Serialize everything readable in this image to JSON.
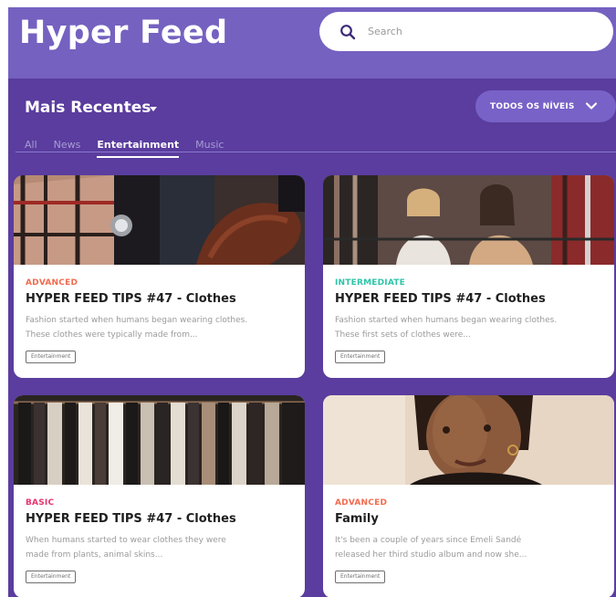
{
  "app": {
    "title": "Hyper Feed"
  },
  "search": {
    "placeholder": "Search"
  },
  "filters": {
    "sort_label": "Mais Recentes",
    "level_button": "TODOS OS NÍVEIS",
    "tabs": [
      {
        "label": "All",
        "active": false
      },
      {
        "label": "News",
        "active": false
      },
      {
        "label": "Entertainment",
        "active": true
      },
      {
        "label": "Music",
        "active": false
      }
    ]
  },
  "cards": [
    {
      "level": "ADVANCED",
      "level_color": "#f26b4f",
      "title": "HYPER FEED TIPS #47 - Clothes",
      "desc_1": "Fashion started when humans began wearing clothes.",
      "desc_2": "These clothes were typically made from...",
      "tag": "Entertainment",
      "image": "clothes-closeup-image"
    },
    {
      "level": "INTERMEDIATE",
      "level_color": "#2ec5a8",
      "title": "HYPER FEED TIPS #47 - Clothes",
      "desc_1": "Fashion started when humans began wearing clothes.",
      "desc_2": "These first sets of clothes were...",
      "tag": "Entertainment",
      "image": "shopping-women-image"
    },
    {
      "level": "BASIC",
      "level_color": "#e8336d",
      "title": "HYPER FEED TIPS #47 - Clothes",
      "desc_1": "When humans started to wear clothes they were",
      "desc_2": "made from plants, animal skins...",
      "tag": "Entertainment",
      "image": "clothing-rack-image"
    },
    {
      "level": "ADVANCED",
      "level_color": "#f26b4f",
      "title": "Family",
      "desc_1": "It's been a couple of years since Emeli Sandé",
      "desc_2": "released her third studio album and now she...",
      "tag": "Entertainment",
      "image": "portrait-woman-image"
    }
  ]
}
